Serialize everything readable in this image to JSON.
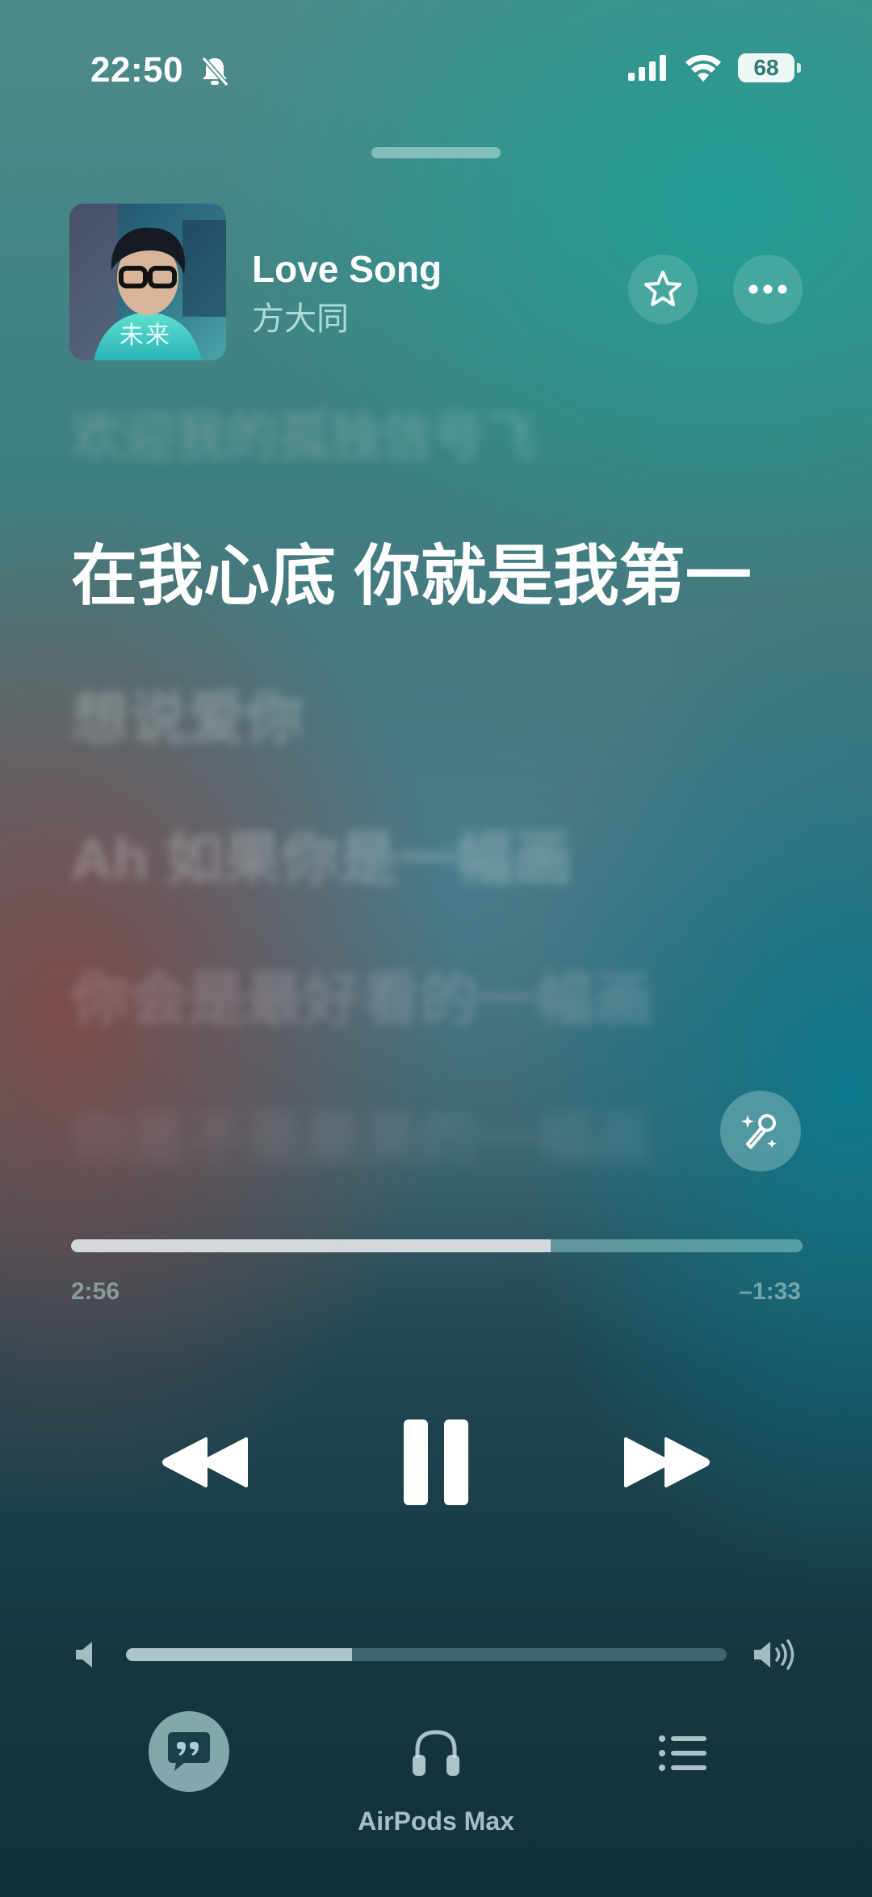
{
  "status_bar": {
    "time": "22:50",
    "battery": "68",
    "icons": [
      "bell-slash-icon",
      "cellular-signal-icon",
      "wifi-icon",
      "battery-icon"
    ]
  },
  "now_playing": {
    "title": "Love Song",
    "artist": "方大同",
    "artwork_text": "未来"
  },
  "lyrics": {
    "previous": "欢迎我的孤独信号飞",
    "current": "在我心底 你就是我第一",
    "upcoming": [
      "想说爱你",
      "Ah 如果你是一幅画",
      "你会是最好看的一幅画",
      "你是不是最美的一幅画"
    ]
  },
  "progress": {
    "elapsed": "2:56",
    "remaining": "–1:33",
    "fraction": 0.656
  },
  "volume": {
    "fraction": 0.376
  },
  "bottom_bar": {
    "airplay_label": "AirPods Max"
  },
  "colors": {
    "accent": "#ffffff",
    "battery_text": "#2d7a78"
  }
}
